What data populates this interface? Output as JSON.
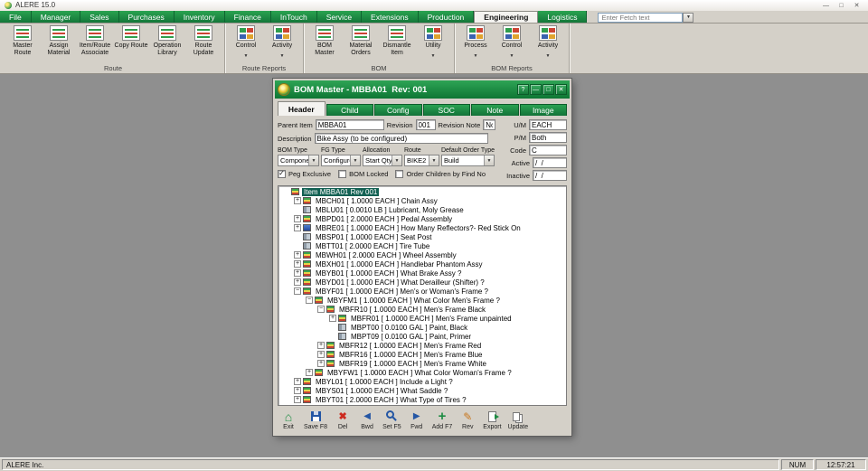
{
  "app": {
    "title": "ALERE 15.0",
    "window_buttons": [
      {
        "name": "minimize",
        "glyph": "—"
      },
      {
        "name": "maximize",
        "glyph": "□"
      },
      {
        "name": "close",
        "glyph": "✕"
      }
    ]
  },
  "menu": {
    "tabs": [
      {
        "label": "File"
      },
      {
        "label": "Manager"
      },
      {
        "label": "Sales"
      },
      {
        "label": "Purchases"
      },
      {
        "label": "Inventory"
      },
      {
        "label": "Finance"
      },
      {
        "label": "InTouch"
      },
      {
        "label": "Service"
      },
      {
        "label": "Extensions"
      },
      {
        "label": "Production"
      },
      {
        "label": "Engineering",
        "active": true
      },
      {
        "label": "Logistics"
      }
    ],
    "fetch_placeholder": "Enter Fetch text"
  },
  "ribbon": {
    "groups": [
      {
        "label": "Route",
        "items": [
          {
            "label": "Master Route",
            "icon": "doc"
          },
          {
            "label": "Assign Material",
            "icon": "doc"
          },
          {
            "label": "Item/Route Associate",
            "icon": "doc"
          },
          {
            "label": "Copy Route",
            "icon": "doc"
          },
          {
            "label": "Operation Library",
            "icon": "doc"
          },
          {
            "label": "Route Update",
            "icon": "doc"
          }
        ]
      },
      {
        "label": "Route Reports",
        "items": [
          {
            "label": "Control",
            "icon": "grid",
            "dropdown": true
          },
          {
            "label": "Activity",
            "icon": "grid",
            "dropdown": true
          }
        ]
      },
      {
        "label": "BOM",
        "items": [
          {
            "label": "BOM Master",
            "icon": "doc"
          },
          {
            "label": "Material Orders",
            "icon": "doc"
          },
          {
            "label": "Dismantle Item",
            "icon": "doc"
          },
          {
            "label": "Utility",
            "icon": "grid",
            "dropdown": true
          }
        ]
      },
      {
        "label": "BOM Reports",
        "items": [
          {
            "label": "Process",
            "icon": "grid",
            "dropdown": true
          },
          {
            "label": "Control",
            "icon": "grid",
            "dropdown": true
          },
          {
            "label": "Activity",
            "icon": "grid",
            "dropdown": true
          }
        ]
      }
    ]
  },
  "dialog": {
    "title": "BOM Master - MBBA01  Rev: 001",
    "title_buttons": [
      {
        "name": "help",
        "glyph": "?"
      },
      {
        "name": "minimize",
        "glyph": "—"
      },
      {
        "name": "maximize",
        "glyph": "□"
      },
      {
        "name": "close",
        "glyph": "✕"
      }
    ],
    "tabs": [
      {
        "label": "Header",
        "active": true
      },
      {
        "label": "Child"
      },
      {
        "label": "Config"
      },
      {
        "label": "SOC"
      },
      {
        "label": "Note"
      },
      {
        "label": "Image"
      }
    ],
    "fields": {
      "parent_item": {
        "label": "Parent Item",
        "value": "MBBA01"
      },
      "revision": {
        "label": "Revision",
        "value": "001"
      },
      "revision_note": {
        "label": "Revision Note",
        "value": "No"
      },
      "um": {
        "label": "U/M",
        "value": "EACH"
      },
      "pm": {
        "label": "P/M",
        "value": "Both"
      },
      "code": {
        "label": "Code",
        "value": "C"
      },
      "description": {
        "label": "Description",
        "value": "Bike Assy (to be configured)"
      },
      "bom_type": {
        "label": "BOM Type",
        "value": "Component"
      },
      "fg_type": {
        "label": "FG Type",
        "value": "Configure"
      },
      "allocation": {
        "label": "Allocation",
        "value": "Start Qty"
      },
      "route": {
        "label": "Route",
        "value": "BIKE2"
      },
      "default_order_type": {
        "label": "Default Order Type",
        "value": "Build"
      },
      "active": {
        "label": "Active",
        "value": "/  /"
      },
      "inactive": {
        "label": "Inactive",
        "value": "/  /"
      }
    },
    "checkboxes": [
      {
        "label": "Peg Exclusive",
        "checked": true
      },
      {
        "label": "BOM Locked",
        "checked": false
      },
      {
        "label": "Order Children by Find No",
        "checked": false
      }
    ],
    "tree": [
      {
        "level": 0,
        "exp": "none",
        "icon": "bom",
        "text": "Item MBBA01 Rev 001",
        "selected": true
      },
      {
        "level": 1,
        "exp": "plus",
        "icon": "bom",
        "text": "MBCH01 [ 1.0000 EACH ] Chain Assy"
      },
      {
        "level": 1,
        "exp": "none",
        "icon": "mat",
        "text": "MBLU01 [ 0.0010 LB ] Lubricant, Moly Grease"
      },
      {
        "level": 1,
        "exp": "plus",
        "icon": "bom",
        "text": "MBPD01 [ 2.0000 EACH ] Pedal Assembly"
      },
      {
        "level": 1,
        "exp": "plus",
        "icon": "blue",
        "text": "MBRE01 [ 1.0000 EACH ] How Many Reflectors?- Red Stick On"
      },
      {
        "level": 1,
        "exp": "none",
        "icon": "mat",
        "text": "MBSP01 [ 1.0000 EACH ] Seat Post"
      },
      {
        "level": 1,
        "exp": "none",
        "icon": "mat",
        "text": "MBTT01 [ 2.0000 EACH ] Tire Tube"
      },
      {
        "level": 1,
        "exp": "plus",
        "icon": "bom",
        "text": "MBWH01 [ 2.0000 EACH ] Wheel Assembly"
      },
      {
        "level": 1,
        "exp": "plus",
        "icon": "bom",
        "text": "MBXH01 [ 1.0000 EACH ] Handlebar Phantom Assy"
      },
      {
        "level": 1,
        "exp": "plus",
        "icon": "bom",
        "text": "MBYB01 [ 1.0000 EACH ] What Brake Assy ?"
      },
      {
        "level": 1,
        "exp": "plus",
        "icon": "bom",
        "text": "MBYD01 [ 1.0000 EACH ] What Derailleur (Shifter) ?"
      },
      {
        "level": 1,
        "exp": "minus",
        "icon": "bom",
        "text": "MBYF01 [ 1.0000 EACH ] Men's or Woman's Frame ?"
      },
      {
        "level": 2,
        "exp": "minus",
        "icon": "bom",
        "text": "MBYFM1 [ 1.0000 EACH ] What Color Men's Frame ?"
      },
      {
        "level": 3,
        "exp": "minus",
        "icon": "bom",
        "text": "MBFR10 [ 1.0000 EACH ] Men's Frame Black"
      },
      {
        "level": 4,
        "exp": "plus",
        "icon": "bom",
        "text": "MBFR01 [ 1.0000 EACH ] Men's Frame unpainted"
      },
      {
        "level": 4,
        "exp": "none",
        "icon": "mat",
        "text": "MBPT00 [ 0.0100 GAL ] Paint, Black"
      },
      {
        "level": 4,
        "exp": "none",
        "icon": "mat",
        "text": "MBPT09 [ 0.0100 GAL ] Paint, Primer"
      },
      {
        "level": 3,
        "exp": "plus",
        "icon": "bom",
        "text": "MBFR12 [ 1.0000 EACH ] Men's Frame Red"
      },
      {
        "level": 3,
        "exp": "plus",
        "icon": "bom",
        "text": "MBFR16 [ 1.0000 EACH ] Men's Frame Blue"
      },
      {
        "level": 3,
        "exp": "plus",
        "icon": "bom",
        "text": "MBFR19 [ 1.0000 EACH ] Men's Frame White"
      },
      {
        "level": 2,
        "exp": "plus",
        "icon": "bom",
        "text": "MBYFW1 [ 1.0000 EACH ] What Color Woman's Frame ?"
      },
      {
        "level": 1,
        "exp": "plus",
        "icon": "bom",
        "text": "MBYL01 [ 1.0000 EACH ] Include a Light ?"
      },
      {
        "level": 1,
        "exp": "plus",
        "icon": "bom",
        "text": "MBYS01 [ 1.0000 EACH ] What Saddle ?"
      },
      {
        "level": 1,
        "exp": "plus",
        "icon": "bom",
        "text": "MBYT01 [ 2.0000 EACH ] What Type of Tires ?"
      }
    ],
    "toolbar": [
      {
        "label": "Exit",
        "icon": "home"
      },
      {
        "label": "Save F8",
        "icon": "floppy"
      },
      {
        "label": "Del",
        "icon": "delete"
      },
      {
        "label": "Bwd",
        "icon": "back"
      },
      {
        "label": "Set F5",
        "icon": "search"
      },
      {
        "label": "Fwd",
        "icon": "forward"
      },
      {
        "label": "Add F7",
        "icon": "plus"
      },
      {
        "label": "Rev",
        "icon": "pencil"
      },
      {
        "label": "Export",
        "icon": "export"
      },
      {
        "label": "Update",
        "icon": "update"
      }
    ]
  },
  "statusbar": {
    "company": "ALERE Inc.",
    "num": "NUM",
    "time": "12:57:21"
  },
  "colors": {
    "green": "#1c8c42",
    "green_dark": "#0e7634",
    "selection": "#136153",
    "chrome": "#d4d0c8"
  }
}
